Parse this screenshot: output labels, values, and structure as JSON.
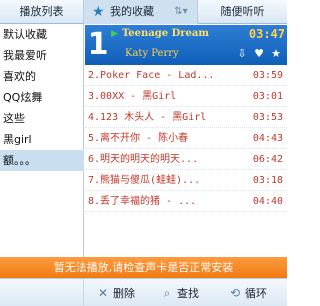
{
  "tabs": {
    "playlist": "播放列表",
    "favorites": "我的收藏",
    "radio": "随便听听",
    "sort_icon": "sort-updown-icon"
  },
  "sidebar": {
    "items": [
      {
        "label": "默认收藏"
      },
      {
        "label": "我最爱听"
      },
      {
        "label": "喜欢的"
      },
      {
        "label": "QQ炫舞"
      },
      {
        "label": "这些"
      },
      {
        "label": "黑girl"
      },
      {
        "label": "额。。。"
      }
    ],
    "selected_index": 6
  },
  "now_playing": {
    "index": "1",
    "title": "Teenage Dream",
    "artist": "Katy Perry",
    "time": "03:47",
    "icons": [
      "download-icon",
      "heart-icon",
      "star-icon"
    ]
  },
  "tracks": [
    {
      "title": "2.Poker Face - Lad...",
      "duration": "03:59"
    },
    {
      "title": "3.00XX - 黑Girl",
      "duration": "03:01"
    },
    {
      "title": "4.123 木头人 - 黑Girl",
      "duration": "03:53"
    },
    {
      "title": "5.离不开你 - 陈小春",
      "duration": "04:43"
    },
    {
      "title": "6.明天的明天的明天...",
      "duration": "06:42"
    },
    {
      "title": "7.熊猫与傻瓜(蛙蛙)...",
      "duration": "03:18"
    },
    {
      "title": "8.丢了幸福的猪 - ...",
      "duration": "04:40"
    }
  ],
  "status_message": "暂无法播放,请检查声卡是否正常安装",
  "toolbar": {
    "delete": "删除",
    "search": "查找",
    "loop": "循环"
  },
  "colors": {
    "accent": "#1468c2",
    "track_text": "#c0392b",
    "status_bar": "#f38a22"
  }
}
